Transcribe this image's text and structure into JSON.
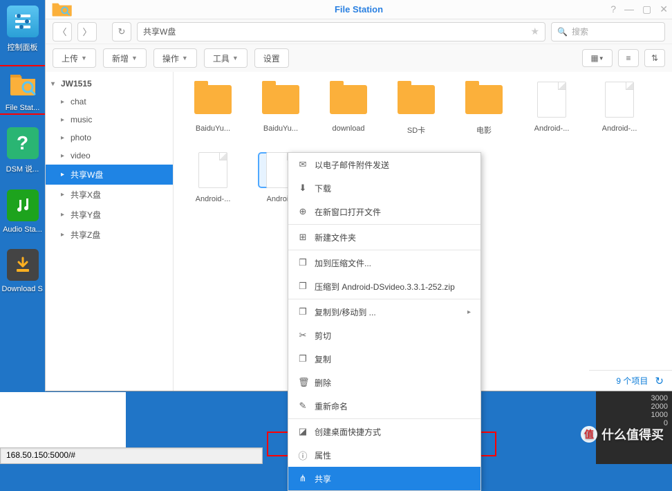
{
  "desktop": {
    "items": [
      {
        "label": "控制面板",
        "highlighted": false
      },
      {
        "label": "File Stat...",
        "highlighted": true
      },
      {
        "label": "DSM 说...",
        "highlighted": false
      },
      {
        "label": "Audio Sta...",
        "highlighted": false
      },
      {
        "label": "Download S...",
        "highlighted": false
      }
    ]
  },
  "window": {
    "title": "File Station",
    "path": "共享W盘",
    "search_placeholder": "搜索",
    "toolbar": {
      "upload": "上传",
      "new": "新增",
      "action": "操作",
      "tools": "工具",
      "settings": "设置"
    },
    "status": {
      "count": "9 个项目"
    }
  },
  "tree": {
    "root": "JW1515",
    "children": [
      {
        "label": "chat"
      },
      {
        "label": "music"
      },
      {
        "label": "photo"
      },
      {
        "label": "video"
      },
      {
        "label": "共享W盘",
        "selected": true
      },
      {
        "label": "共享X盘"
      },
      {
        "label": "共享Y盘"
      },
      {
        "label": "共享Z盘"
      }
    ]
  },
  "files": [
    {
      "name": "BaiduYu...",
      "type": "folder"
    },
    {
      "name": "BaiduYu...",
      "type": "folder"
    },
    {
      "name": "download",
      "type": "folder"
    },
    {
      "name": "SD卡",
      "type": "folder"
    },
    {
      "name": "电影",
      "type": "folder"
    },
    {
      "name": "Android-...",
      "type": "file"
    },
    {
      "name": "Android-...",
      "type": "file"
    },
    {
      "name": "Android-...",
      "type": "file"
    },
    {
      "name": "Androi...",
      "type": "file",
      "selected": true
    }
  ],
  "context_menu": [
    {
      "icon": "✉",
      "label": "以电子邮件附件发送"
    },
    {
      "icon": "⬇",
      "label": "下载"
    },
    {
      "icon": "⊕",
      "label": "在新窗口打开文件"
    },
    {
      "sep": true
    },
    {
      "icon": "⊞",
      "label": "新建文件夹"
    },
    {
      "sep": true
    },
    {
      "icon": "❐",
      "label": "加到压缩文件..."
    },
    {
      "icon": "❐",
      "label": "压缩到 Android-DSvideo.3.3.1-252.zip"
    },
    {
      "sep": true
    },
    {
      "icon": "❐",
      "label": "复制到/移动到 ...",
      "submenu": true
    },
    {
      "icon": "✂",
      "label": "剪切"
    },
    {
      "icon": "❐",
      "label": "复制"
    },
    {
      "icon": "🗑",
      "label": "删除"
    },
    {
      "icon": "✎",
      "label": "重新命名"
    },
    {
      "sep": true
    },
    {
      "icon": "◪",
      "label": "创建桌面快捷方式"
    },
    {
      "icon": "ⓘ",
      "label": "属性"
    },
    {
      "icon": "⋔",
      "label": "共享",
      "selected": true
    }
  ],
  "side_numbers": [
    "3000",
    "2000",
    "1000",
    "0"
  ],
  "address_bar": "168.50.150:5000/#",
  "watermark": "什么值得买"
}
